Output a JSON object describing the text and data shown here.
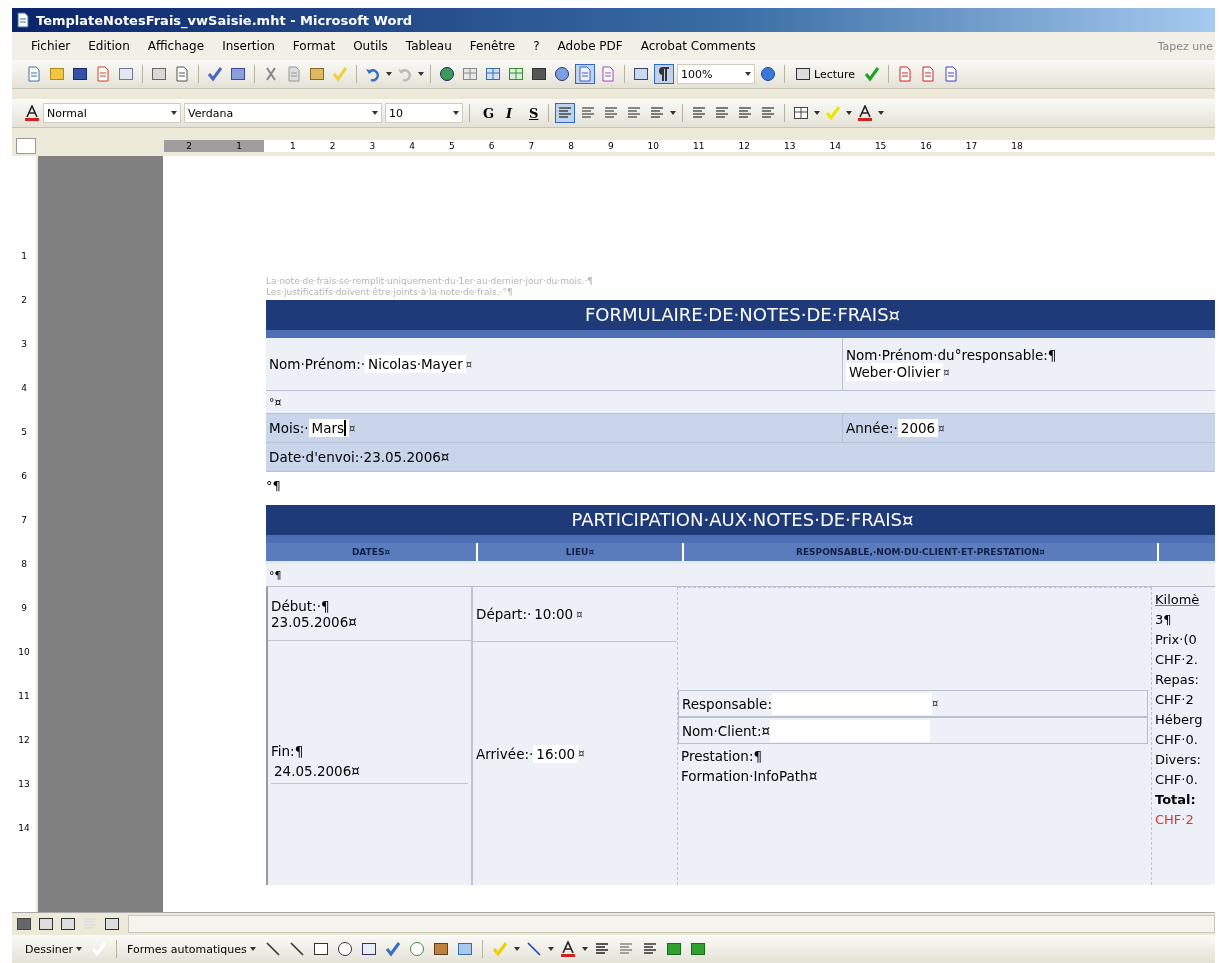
{
  "window": {
    "title": "TemplateNotesFrais_vwSaisie.mht - Microsoft Word"
  },
  "menu": [
    "Fichier",
    "Edition",
    "Affichage",
    "Insertion",
    "Format",
    "Outils",
    "Tableau",
    "Fenêtre",
    "?",
    "Adobe PDF",
    "Acrobat Comments"
  ],
  "help_box": {
    "placeholder": "Tapez une"
  },
  "standard_toolbar": {
    "document_map_pressed": true,
    "show_marks_pressed": true,
    "zoom": "100%",
    "read_button": "Lecture"
  },
  "format_toolbar": {
    "style": "Normal",
    "font": "Verdana",
    "size": "10",
    "bold": "G",
    "italic": "I",
    "underline": "S",
    "align_left_pressed": true
  },
  "ruler": {
    "left_labels": [
      "2",
      "1"
    ],
    "labels": [
      "1",
      "2",
      "3",
      "4",
      "5",
      "6",
      "7",
      "8",
      "9",
      "10",
      "11",
      "12",
      "13",
      "14",
      "15",
      "16",
      "17",
      "18"
    ]
  },
  "vertical_ruler": [
    "1",
    "2",
    "3",
    "4",
    "5",
    "6",
    "7",
    "8",
    "9",
    "10",
    "11",
    "12",
    "13",
    "14"
  ],
  "notes": [
    "La·note·de·frais·se·remplit·uniquement·du·1er·au·dernier·jour·du·mois.·¶",
    "Les·justificatifs·doivent·être·joints·à·la·note·de·frais.·°¶"
  ],
  "form": {
    "title": "FORMULAIRE·DE·NOTES·DE·FRAIS¤",
    "name": {
      "label": "Nom·Prénom:·",
      "value": "Nicolas·Mayer",
      "mark": "¤"
    },
    "manager": {
      "label": "Nom·Prénom·du°responsable:¶",
      "value": "Weber·Olivier",
      "mark": "¤"
    },
    "spacer": "°¤",
    "month": {
      "label": "Mois:·",
      "value": "Mars",
      "mark": "¤",
      "cursor": true
    },
    "year": {
      "label": "Année:·",
      "value": "2006",
      "mark": "¤"
    },
    "sent_date": {
      "label": "Date·d'envoi:·23.05.2006¤"
    }
  },
  "after_form": "°¶",
  "participation": {
    "title": "PARTICIPATION·AUX·NOTES·DE·FRAIS¤",
    "columns": [
      "DATES¤",
      "LIEU¤",
      "RESPONSABLE,·NOM·DU·CLIENT·ET·PRESTATION¤"
    ],
    "spacer": "°¶",
    "start_label": "Début:·¶",
    "start_date": "23.05.2006¤",
    "end_label": "Fin:¶",
    "end_date": "24.05.2006¤",
    "departure": {
      "label": "Départ:·",
      "value": "10:00",
      "mark": "¤"
    },
    "arrival": {
      "label": "Arrivée:·",
      "value": "16:00",
      "mark": "¤"
    },
    "responsable": {
      "before": "Responsable:",
      "after": "¤"
    },
    "client": {
      "before": "Nom·Client:¤"
    },
    "service_label": "Prestation:¶",
    "service": "Formation·InfoPath¤",
    "costs": [
      {
        "kind": "underlined",
        "text": "Kilomè"
      },
      {
        "kind": "plain",
        "text": "3¶"
      },
      {
        "kind": "plain",
        "text": "Prix·(0"
      },
      {
        "kind": "plain",
        "text": "CHF·2."
      },
      {
        "kind": "plain",
        "text": "Repas:"
      },
      {
        "kind": "plain",
        "text": "CHF·2"
      },
      {
        "kind": "plain",
        "text": "Héberg"
      },
      {
        "kind": "plain",
        "text": "CHF·0."
      },
      {
        "kind": "plain",
        "text": "Divers:"
      },
      {
        "kind": "plain",
        "text": "CHF·0."
      },
      {
        "kind": "bold",
        "text": "Total:"
      },
      {
        "kind": "red",
        "text": "CHF·2"
      }
    ]
  },
  "drawing_toolbar": {
    "draw_menu": "Dessiner",
    "shapes_menu": "Formes automatiques"
  }
}
